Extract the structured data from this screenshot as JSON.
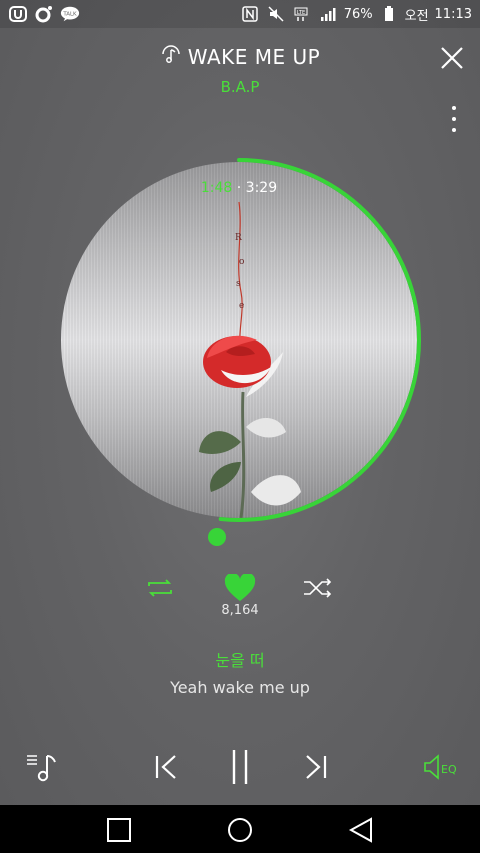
{
  "status_bar": {
    "battery_percent": "76%",
    "ampm": "오전",
    "time": "11:13",
    "icons": [
      "app-u-icon",
      "app-circle-icon",
      "talk-icon",
      "nfc-icon",
      "mute-icon",
      "lte-icon",
      "signal-icon",
      "battery-icon"
    ],
    "talk_label": "TALK"
  },
  "header": {
    "title": "WAKE ME UP",
    "artist": "B.A.P"
  },
  "playback": {
    "current_time": "1:48",
    "separator": "·",
    "total_time": "3:29",
    "progress_fraction": 0.516
  },
  "actions": {
    "like_count": "8,164"
  },
  "lyrics": {
    "current": "눈을 떠",
    "next": "Yeah wake me up"
  },
  "player": {
    "eq_label": "EQ"
  },
  "colors": {
    "accent": "#4ade3a",
    "background": "#636365",
    "navbar": "#000000"
  }
}
